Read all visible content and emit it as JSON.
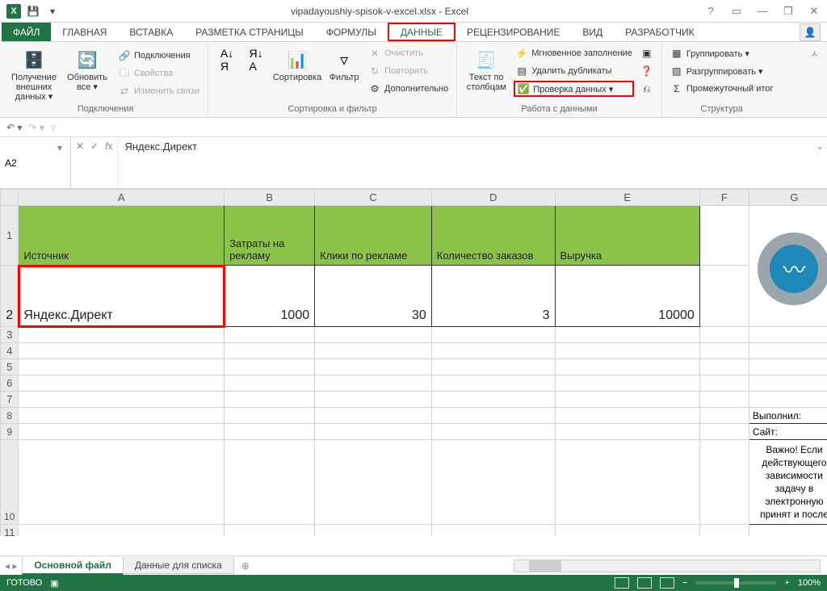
{
  "app": {
    "title": "vipadayoushiy-spisok-v-excel.xlsx - Excel"
  },
  "tabs": {
    "file": "ФАЙЛ",
    "home": "ГЛАВНАЯ",
    "insert": "ВСТАВКА",
    "pagelayout": "РАЗМЕТКА СТРАНИЦЫ",
    "formulas": "ФОРМУЛЫ",
    "data": "ДАННЫЕ",
    "review": "РЕЦЕНЗИРОВАНИЕ",
    "view": "ВИД",
    "developer": "РАЗРАБОТЧИК"
  },
  "ribbon": {
    "g_connections": {
      "label": "Подключения",
      "get_external": "Получение внешних данных ▾",
      "refresh_all": "Обновить все ▾",
      "connections": "Подключения",
      "properties": "Свойства",
      "edit_links": "Изменить связи"
    },
    "g_sort": {
      "label": "Сортировка и фильтр",
      "sort": "Сортировка",
      "filter": "Фильтр",
      "clear": "Очистить",
      "reapply": "Повторить",
      "advanced": "Дополнительно"
    },
    "g_tools": {
      "label": "Работа с данными",
      "text_to_cols": "Текст по столбцам",
      "flash_fill": "Мгновенное заполнение",
      "remove_dup": "Удалить дубликаты",
      "data_validation": "Проверка данных  ▾"
    },
    "g_outline": {
      "label": "Структура",
      "group": "Группировать ▾",
      "ungroup": "Разгруппировать ▾",
      "subtotal": "Промежуточный итог"
    }
  },
  "formula_bar": {
    "cell_ref": "A2",
    "value": "Яндекс.Директ"
  },
  "columns": [
    "A",
    "B",
    "C",
    "D",
    "E",
    "F",
    "G"
  ],
  "headers": {
    "A": "Источник",
    "B": "Затраты на рекламу",
    "C": "Клики по рекламе",
    "D": "Количество заказов",
    "E": "Выручка"
  },
  "row2": {
    "A": "Яндекс.Директ",
    "B": "1000",
    "C": "30",
    "D": "3",
    "E": "10000"
  },
  "side": {
    "performed": "Выполнил:",
    "site": "Сайт:",
    "note": "Важно! Если действующего зависимости задачу в электронную принят и после"
  },
  "sheets": {
    "active": "Основной файл",
    "other": "Данные для списка"
  },
  "status": {
    "ready": "ГОТОВО",
    "zoom": "100%"
  }
}
